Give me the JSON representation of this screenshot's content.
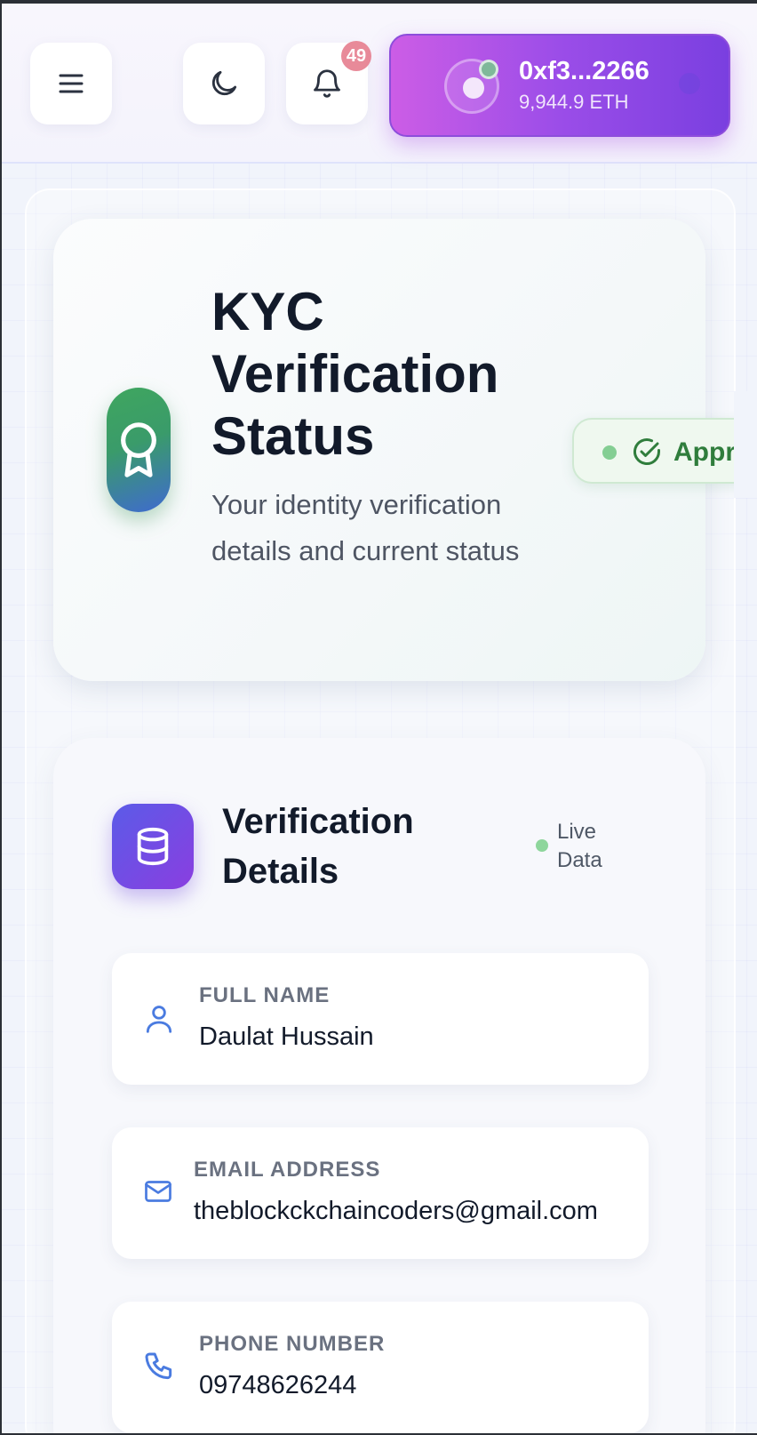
{
  "header": {
    "notifications_count": "49",
    "wallet": {
      "address": "0xf3...2266",
      "balance": "9,944.9 ETH"
    },
    "icons": [
      "menu-icon",
      "moon-icon",
      "bell-icon"
    ]
  },
  "status_card": {
    "title": "KYC Verification Status",
    "subtitle": "Your identity verification details and current status",
    "status": "Approved",
    "accent_color": "#2f7d3c"
  },
  "details_card": {
    "title": "Verification Details",
    "live_label": "Live Data",
    "fields": [
      {
        "label": "FULL NAME",
        "value": "Daulat Hussain",
        "icon": "user-icon"
      },
      {
        "label": "EMAIL ADDRESS",
        "value": "theblockckchaincoders@gmail.com",
        "icon": "mail-icon"
      },
      {
        "label": "PHONE NUMBER",
        "value": "09748626244",
        "icon": "phone-icon"
      }
    ]
  },
  "colors": {
    "wallet_gradient": [
      "#cc5de6",
      "#7a3fe0"
    ],
    "icon_accent": "#4a7be0",
    "badge": "#e88a99"
  }
}
